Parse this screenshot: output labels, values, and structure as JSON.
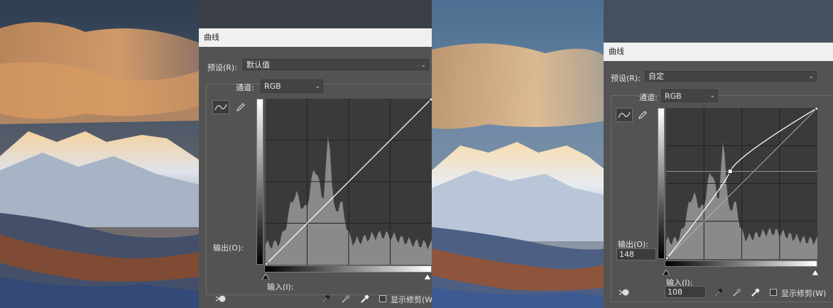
{
  "left_dialog": {
    "title": "曲线",
    "preset_label": "预设(R):",
    "preset_value": "默认值",
    "channel_label": "通道:",
    "channel_value": "RGB",
    "output_label": "输出(O):",
    "input_label": "输入(I):",
    "show_clipping_label": "显示修剪(W)"
  },
  "right_dialog": {
    "title": "曲线",
    "preset_label": "预设(R):",
    "preset_value": "自定",
    "channel_label": "通道:",
    "channel_value": "RGB",
    "output_label": "输出(O):",
    "output_value": "148",
    "input_label": "输入(I):",
    "input_value": "108",
    "show_clipping_label": "显示修剪(W)"
  },
  "curves": {
    "left_points": [
      [
        0,
        0
      ],
      [
        255,
        255
      ]
    ],
    "right_points": [
      [
        0,
        0
      ],
      [
        108,
        148
      ],
      [
        255,
        255
      ]
    ]
  },
  "icons": [
    "curve-tool-icon",
    "pencil-icon",
    "on-image-adjust-icon",
    "black-eyedropper-icon",
    "gray-eyedropper-icon",
    "white-eyedropper-icon",
    "black-point-slider-icon",
    "white-point-slider-icon"
  ]
}
